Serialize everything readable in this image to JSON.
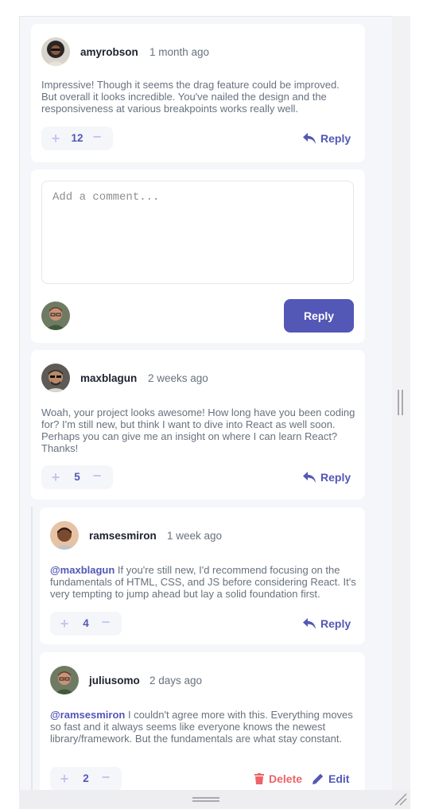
{
  "comments": [
    {
      "username": "amyrobson",
      "time": "1 month ago",
      "content": "Impressive! Though it seems the drag feature could be improved. But overall it looks incredible. You've nailed the design and the responsiveness at various breakpoints works really well.",
      "score": "12",
      "reply_label": "Reply"
    },
    {
      "username": "maxblagun",
      "time": "2 weeks ago",
      "content": "Woah, your project looks awesome! How long have you been coding for? I'm still new, but think I want to dive into React as well soon. Perhaps you can give me an insight on where I can learn React? Thanks!",
      "score": "5",
      "reply_label": "Reply"
    }
  ],
  "replies": [
    {
      "username": "ramsesmiron",
      "time": "1 week ago",
      "mention": "@maxblagun",
      "content": " If you're still new, I'd recommend focusing on the fundamentals of HTML, CSS, and JS before considering React. It's very tempting to jump ahead but lay a solid foundation first.",
      "score": "4",
      "reply_label": "Reply"
    },
    {
      "username": "juliusomo",
      "time": "2 days ago",
      "mention": "@ramsesmiron",
      "content": " I couldn't agree more with this. Everything moves so fast and it always seems like everyone knows the newest library/framework. But the fundamentals are what stay constant.",
      "score": "2",
      "delete_label": "Delete",
      "edit_label": "Edit"
    }
  ],
  "reply_form": {
    "placeholder": "Add a comment...",
    "button_label": "Reply"
  },
  "score_controls": {
    "plus": "+",
    "minus": "−"
  },
  "colors": {
    "accent": "#5357b6",
    "accent_light": "#c5c6ef",
    "danger": "#ed6368",
    "text_dark": "#1e2230",
    "text_muted": "#67727e",
    "background": "#f5f6fa"
  },
  "icons": [
    "reply-icon",
    "delete-icon",
    "edit-icon",
    "plus-icon",
    "minus-icon"
  ]
}
